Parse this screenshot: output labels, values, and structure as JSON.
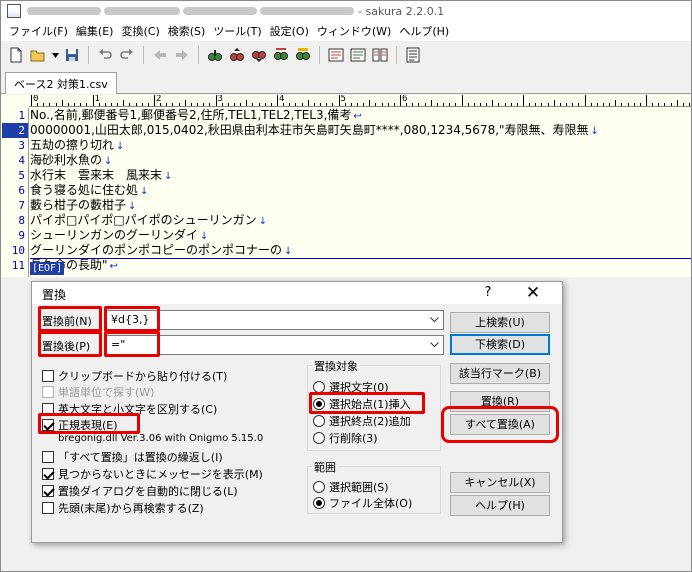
{
  "window": {
    "title_suffix": "- sakura 2.2.0.1"
  },
  "menu": [
    "ファイル(F)",
    "編集(E)",
    "変換(C)",
    "検索(S)",
    "ツール(T)",
    "設定(O)",
    "ウィンドウ(W)",
    "ヘルプ(H)"
  ],
  "toolbar": {
    "icons": [
      "new-file-icon",
      "open-folder-icon",
      "dropdown-arrow-icon",
      "save-icon",
      "undo-icon",
      "redo-icon",
      "jump-back-icon",
      "jump-forward-icon",
      "search-icon",
      "search-prev-icon",
      "search-next-icon",
      "replace-icon",
      "highlight-icon",
      "grep-icon",
      "grep-replace-icon",
      "compare-icon",
      "window-list-icon"
    ]
  },
  "tab": {
    "label": "ベース2 対策1.csv"
  },
  "editor": {
    "ruler_marks": [
      "0",
      "1",
      "2",
      "3",
      "4",
      "5",
      "6"
    ],
    "line_numbers": [
      "1",
      "2",
      "3",
      "4",
      "5",
      "6",
      "7",
      "8",
      "9",
      "10",
      "11"
    ],
    "lines": [
      "No.,名前,郵便番号1,郵便番号2,住所,TEL1,TEL2,TEL3,備考",
      "00000001,山田太郎,015,0402,秋田県由利本荘市矢島町矢島町****,080,1234,5678,\"寿限無、寿限無",
      "五劫の擦り切れ",
      "海砂利水魚の",
      "水行末　雲来末　風来末",
      "食う寝る処に住む処",
      "藪ら柑子の藪柑子",
      "パイポ□パイポ□パイポのシューリンガン",
      "シューリンガンのグーリンダイ",
      "グーリンダイのポンポコピーのポンポコナーの",
      "長久命の長助\""
    ],
    "line_endings": [
      "↩",
      "↓",
      "↓",
      "↓",
      "↓",
      "↓",
      "↓",
      "↓",
      "↓",
      "↓",
      "↩"
    ],
    "eof_label": "[EOF]"
  },
  "dialog": {
    "title": "置換",
    "help_glyph": "?",
    "close_glyph": "✕",
    "find_label": "置換前(N)",
    "find_value": "¥d{3,}",
    "replace_label": "置換後(P)",
    "replace_value": "=\"",
    "buttons": {
      "search_up": "上検索(U)",
      "search_down": "下検索(D)",
      "mark": "該当行マーク(B)",
      "replace": "置換(R)",
      "replace_all": "すべて置換(A)",
      "cancel": "キャンセル(X)",
      "help": "ヘルプ(H)"
    },
    "options": [
      {
        "label": "クリップボードから貼り付ける(T)",
        "checked": false,
        "enabled": true
      },
      {
        "label": "単語単位で探す(W)",
        "checked": false,
        "enabled": false
      },
      {
        "label": "英大文字と小文字を区別する(C)",
        "checked": false,
        "enabled": true
      },
      {
        "label": "正規表現(E)",
        "checked": true,
        "enabled": true
      },
      {
        "label": "「すべて置換」は置換の繰返し(I)",
        "checked": false,
        "enabled": true
      },
      {
        "label": "見つからないときにメッセージを表示(M)",
        "checked": true,
        "enabled": true
      },
      {
        "label": "置換ダイアログを自動的に閉じる(L)",
        "checked": true,
        "enabled": true
      },
      {
        "label": "先頭(末尾)から再検索する(Z)",
        "checked": false,
        "enabled": true
      }
    ],
    "regex_lib_info": "bregonig.dll Ver.3.06 with Onigmo 5.15.0",
    "target_group": {
      "title": "置換対象",
      "options": [
        "選択文字(0)",
        "選択始点(1)挿入",
        "選択終点(2)追加",
        "行削除(3)"
      ],
      "selected_index": 1
    },
    "range_group": {
      "title": "範囲",
      "options": [
        "選択範囲(S)",
        "ファイル全体(O)"
      ],
      "selected_index": 1
    },
    "highlight_color": "#e60000"
  }
}
